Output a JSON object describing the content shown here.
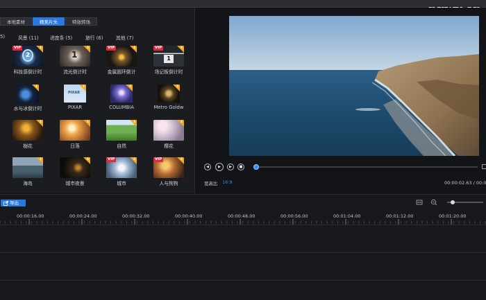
{
  "watermark": "pxwy.cn",
  "tabs": [
    {
      "label": "本地素材",
      "active": false
    },
    {
      "label": "精美片头",
      "active": true
    },
    {
      "label": "特效转场",
      "active": false
    }
  ],
  "categories": [
    "5)",
    "风景 (11)",
    "进度条 (5)",
    "旅行 (6)",
    "其他 (7)"
  ],
  "items": [
    {
      "label": "科技感倒计时",
      "vip": "VIP"
    },
    {
      "label": "流光倒计时",
      "vip": ""
    },
    {
      "label": "金属圆环倒计",
      "vip": "VIP"
    },
    {
      "label": "场记板倒计时",
      "vip": "VIP"
    },
    {
      "label": "水与冰倒计时",
      "vip": ""
    },
    {
      "label": "PIXAR",
      "vip": ""
    },
    {
      "label": "COLUMBIA",
      "vip": ""
    },
    {
      "label": "Metro Goldw",
      "vip": ""
    },
    {
      "label": "樹花",
      "vip": ""
    },
    {
      "label": "日落",
      "vip": ""
    },
    {
      "label": "自然",
      "vip": ""
    },
    {
      "label": "樱花",
      "vip": ""
    },
    {
      "label": "海岛",
      "vip": ""
    },
    {
      "label": "城市夜景",
      "vip": ""
    },
    {
      "label": "城市",
      "vip": "VIP"
    },
    {
      "label": "人与狗狗",
      "vip": "VIP"
    }
  ],
  "download_icon": "↓",
  "preview": {
    "aspect_label": "宽高比",
    "aspect_value": "16:9",
    "timecode": "00:00:02.63  /  00:0",
    "progress": 0.0
  },
  "timeline": {
    "export_label": "导出",
    "ruler_ticks": [
      "00:00:16.00",
      "00:00:24.00",
      "00:00:32.00",
      "00:00:40.00",
      "00:00:48.00",
      "00:00:56.00",
      "00:01:04.00",
      "00:01:12.00",
      "00:01:20.00"
    ],
    "zoom_level": 0.1
  },
  "colors": {
    "accent": "#2a78e4",
    "vip": "#e8283a",
    "download": "#f3a51b"
  }
}
